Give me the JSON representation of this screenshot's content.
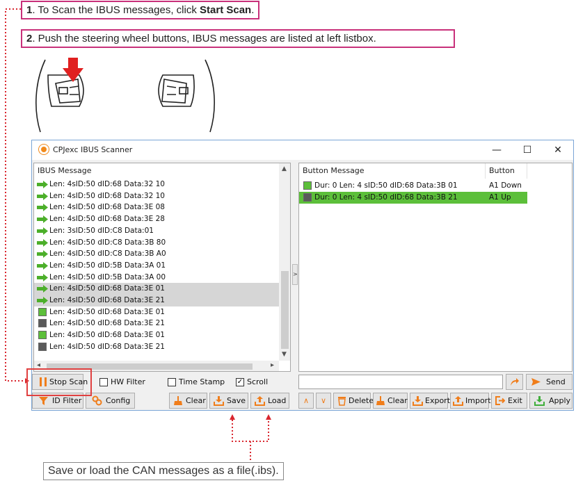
{
  "callouts": {
    "step1_num": "1",
    "step1_text": ". To Scan the IBUS messages, click ",
    "step1_bold": "Start Scan",
    "step1_end": ".",
    "step2_num": "2",
    "step2_text": ". Push the steering wheel buttons, IBUS messages are listed at left listbox.",
    "bottom_note": "Save or load the CAN messages as a file(.ibs)."
  },
  "window": {
    "title": "CPJexc IBUS Scanner",
    "minimize": "—",
    "maximize": "☐",
    "close": "✕"
  },
  "left_panel": {
    "header": "IBUS Message",
    "rows": [
      {
        "text": "Len: 4sID:50 dID:68 Data:32 10",
        "kind": "arrow",
        "selected": false
      },
      {
        "text": "Len: 4sID:50 dID:68 Data:32 10",
        "kind": "arrow",
        "selected": false
      },
      {
        "text": "Len: 4sID:50 dID:68 Data:3E 08",
        "kind": "arrow",
        "selected": false
      },
      {
        "text": "Len: 4sID:50 dID:68 Data:3E 28",
        "kind": "arrow",
        "selected": false
      },
      {
        "text": "Len: 3sID:50 dID:C8 Data:01",
        "kind": "arrow",
        "selected": false
      },
      {
        "text": "Len: 4sID:50 dID:C8 Data:3B 80",
        "kind": "arrow",
        "selected": false
      },
      {
        "text": "Len: 4sID:50 dID:C8 Data:3B A0",
        "kind": "arrow",
        "selected": false
      },
      {
        "text": "Len: 4sID:50 dID:5B Data:3A 01",
        "kind": "arrow",
        "selected": false
      },
      {
        "text": "Len: 4sID:50 dID:5B Data:3A 00",
        "kind": "arrow",
        "selected": false
      },
      {
        "text": "Len: 4sID:50 dID:68 Data:3E 01",
        "kind": "arrow",
        "selected": true
      },
      {
        "text": "Len: 4sID:50 dID:68 Data:3E 21",
        "kind": "arrow",
        "selected": true
      },
      {
        "text": "Len: 4sID:50 dID:68 Data:3E 01",
        "kind": "green",
        "selected": false
      },
      {
        "text": "Len: 4sID:50 dID:68 Data:3E 21",
        "kind": "gray",
        "selected": false
      },
      {
        "text": "Len: 4sID:50 dID:68 Data:3E 01",
        "kind": "green",
        "selected": false
      },
      {
        "text": "Len: 4sID:50 dID:68 Data:3E 21",
        "kind": "gray",
        "selected": false
      }
    ]
  },
  "right_panel": {
    "header_message": "Button Message",
    "header_button": "Button",
    "rows": [
      {
        "text": "Dur:  0 Len: 4 sID:50 dID:68 Data:3B 01",
        "button": "A1 Down",
        "kind": "green",
        "selected": false
      },
      {
        "text": "Dur:  0 Len: 4 sID:50 dID:68 Data:3B 21",
        "button": "A1 Up",
        "kind": "gray",
        "selected": true
      }
    ]
  },
  "splitter_label": ">",
  "controls": {
    "stop_scan": "Stop Scan",
    "hw_filter": "HW Filter",
    "time_stamp": "Time Stamp",
    "scroll": "Scroll",
    "send": "Send",
    "id_filter": "ID Filter",
    "config": "Config",
    "clear_left": "Clear",
    "save": "Save",
    "load": "Load",
    "delete": "Delete",
    "clear_right": "Clear",
    "export": "Export",
    "import": "Import",
    "exit": "Exit",
    "apply": "Apply",
    "send_input_value": ""
  },
  "colors": {
    "accent": "#c8307a",
    "arrow_green": "#4caf2a",
    "selection_green": "#5cbf3a",
    "orange_icon": "#f07d1a",
    "red_marker": "#e02020"
  }
}
